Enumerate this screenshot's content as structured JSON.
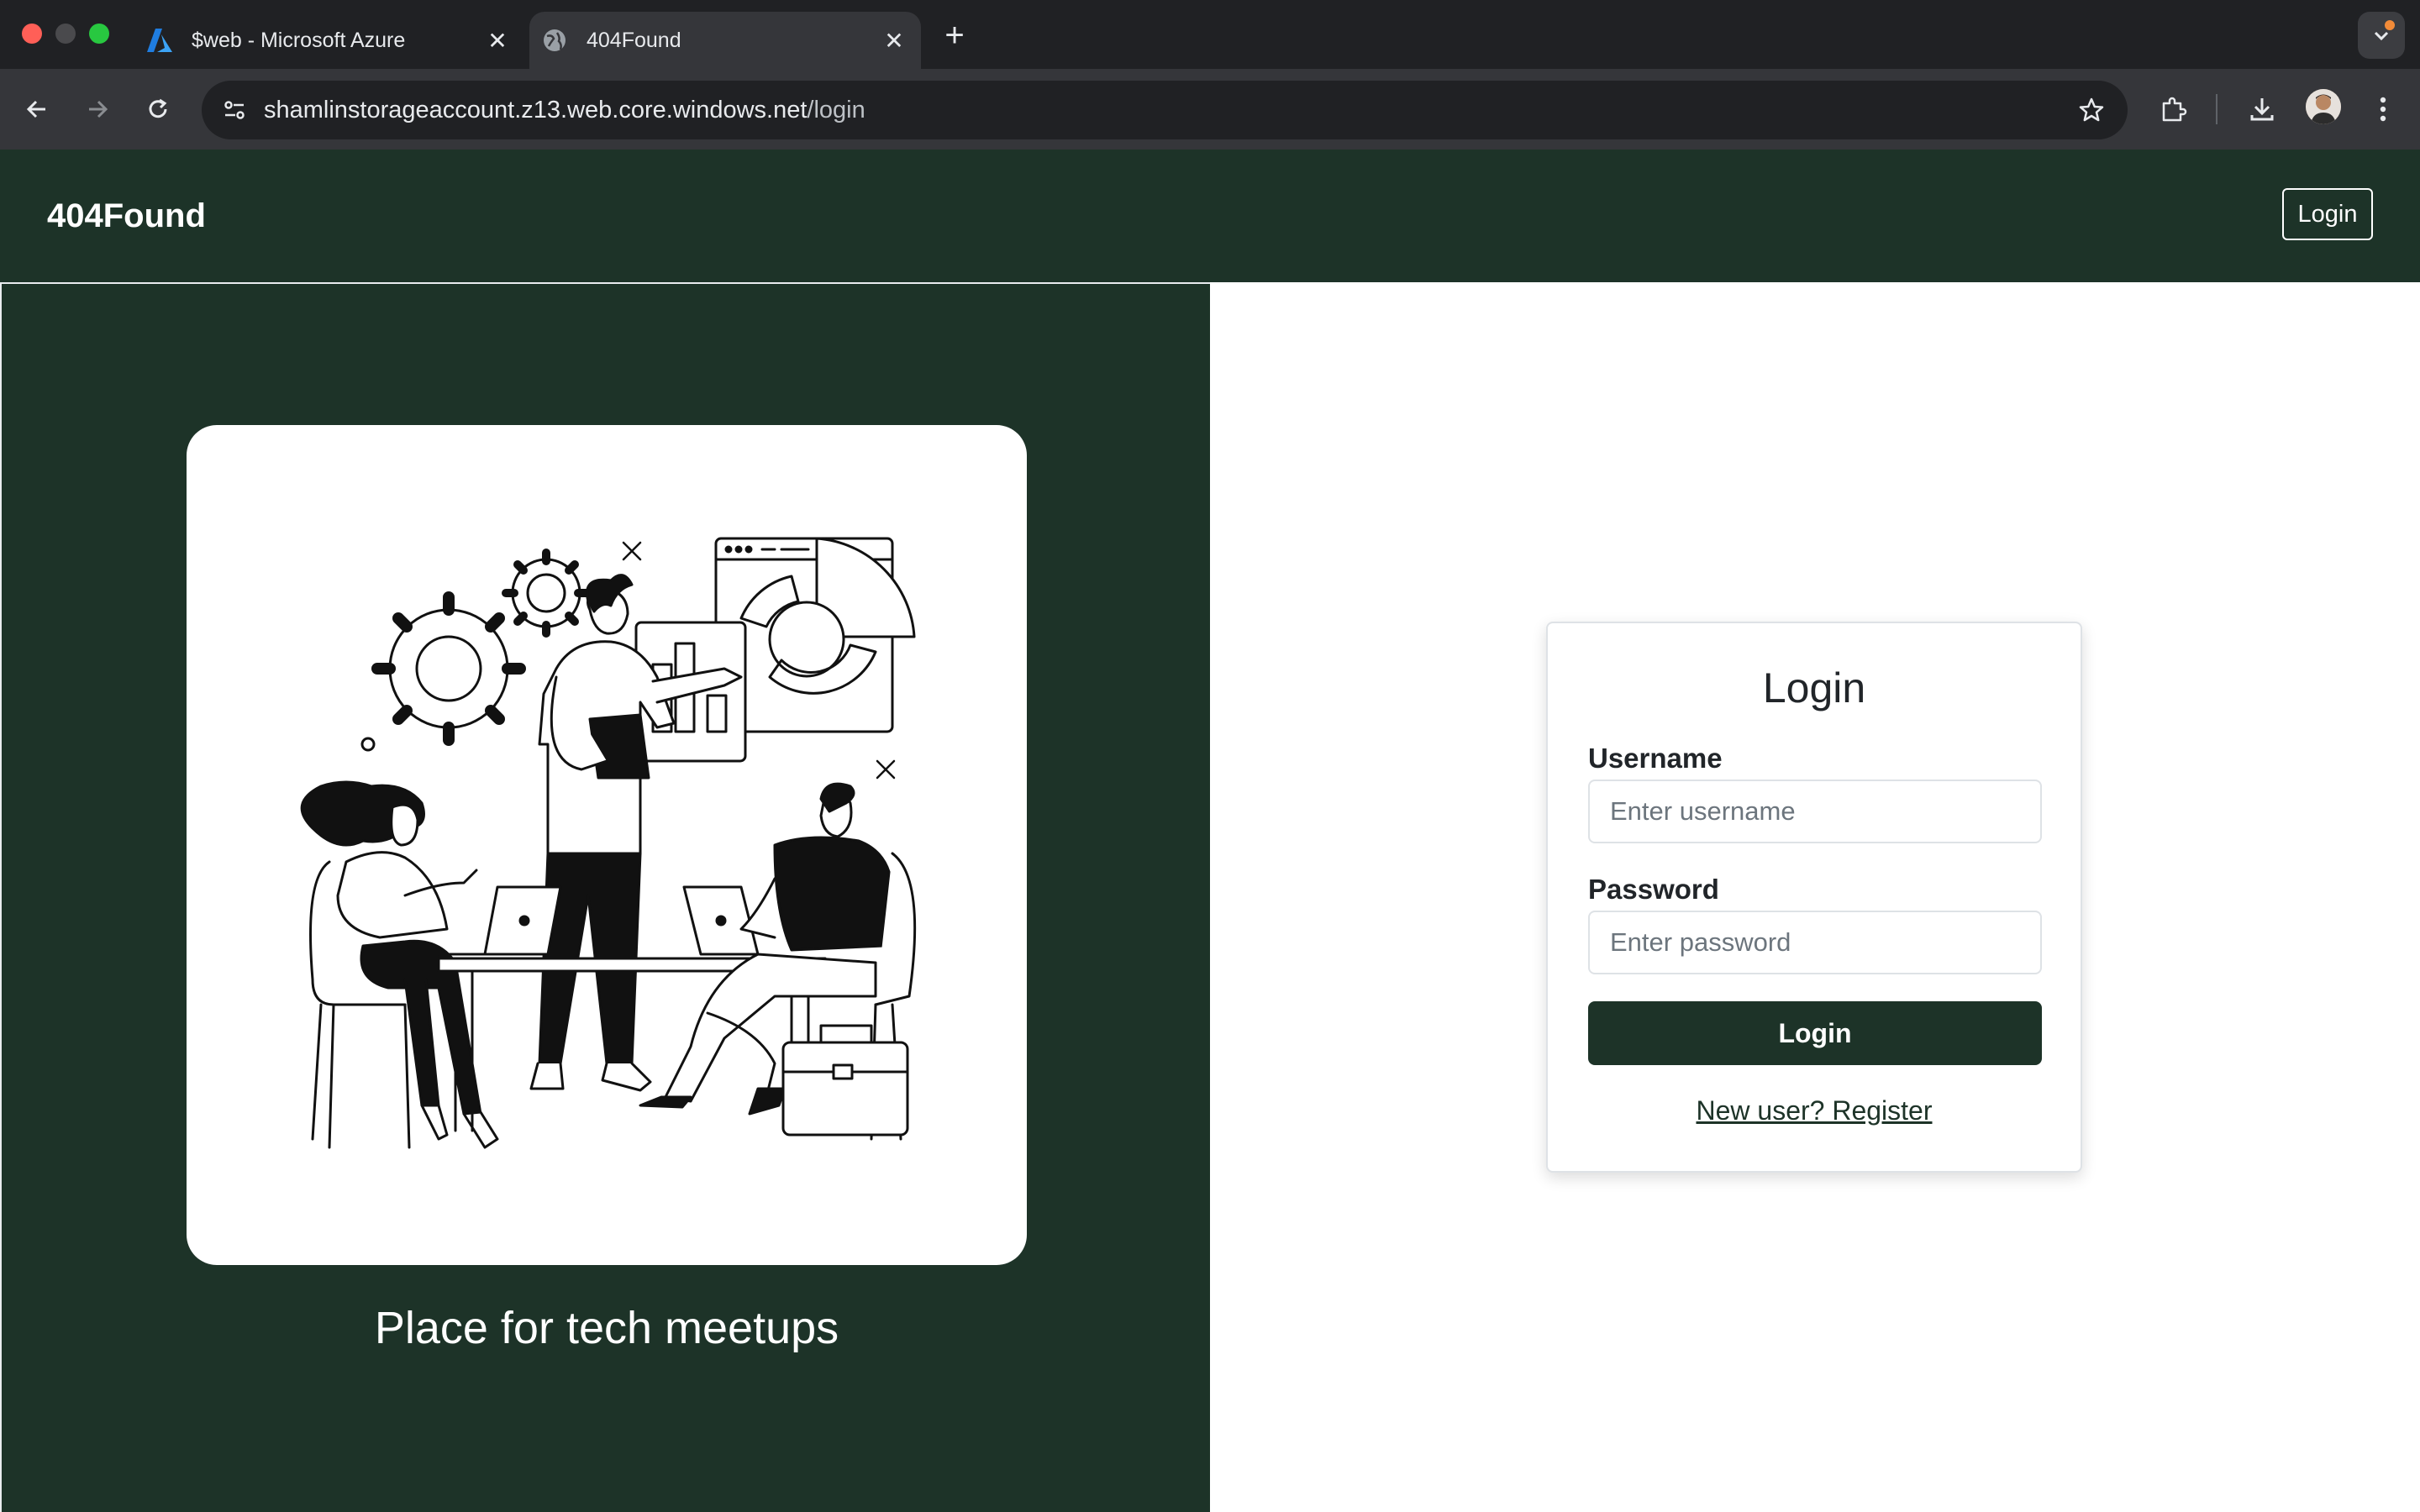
{
  "browser": {
    "tabs": [
      {
        "title": "$web - Microsoft Azure",
        "favicon": "azure-icon",
        "active": false
      },
      {
        "title": "404Found",
        "favicon": "globe-icon",
        "active": true
      }
    ],
    "url_host": "shamlinstorageaccount.z13.web.core.windows.net",
    "url_path": "/login",
    "colors": {
      "tabbar": "#202124",
      "toolbar": "#35363a",
      "omnibox": "#202124"
    }
  },
  "header": {
    "brand": "404Found",
    "login_label": "Login"
  },
  "hero": {
    "tagline": "Place for tech meetups",
    "illustration": "team-meeting-illustration"
  },
  "login_form": {
    "title": "Login",
    "username_label": "Username",
    "username_placeholder": "Enter username",
    "password_label": "Password",
    "password_placeholder": "Enter password",
    "submit_label": "Login",
    "register_link": "New user? Register"
  },
  "colors": {
    "brand_green": "#1d3328",
    "card_border": "#dee2e6",
    "text_dark": "#212529"
  }
}
